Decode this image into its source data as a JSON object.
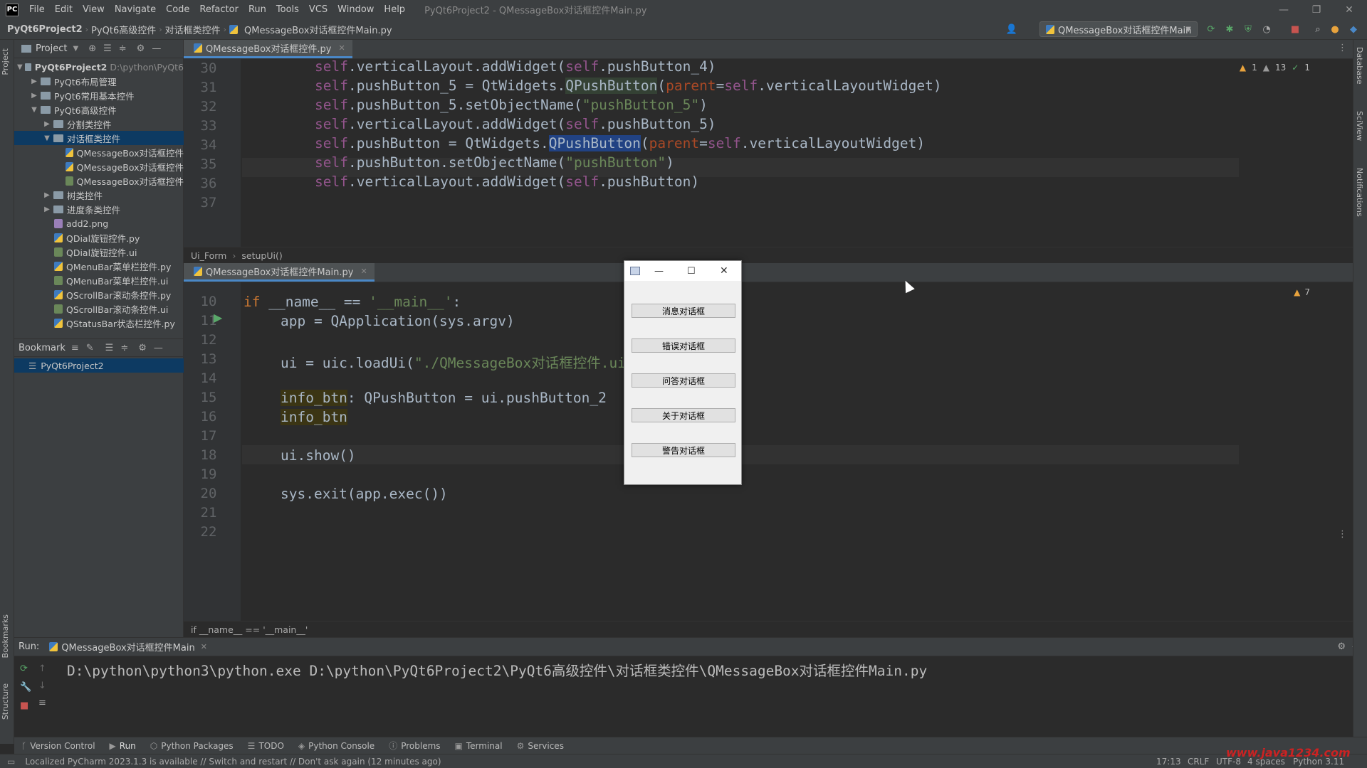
{
  "window": {
    "title": "PyQt6Project2 - QMessageBox对话框控件Main.py",
    "menu": [
      "File",
      "Edit",
      "View",
      "Navigate",
      "Code",
      "Refactor",
      "Run",
      "Tools",
      "VCS",
      "Window",
      "Help"
    ]
  },
  "navbar": {
    "crumbs": [
      "PyQt6Project2",
      "PyQt6高级控件",
      "对话框类控件",
      "QMessageBox对话框控件Main.py"
    ],
    "run_config": "QMessageBox对话框控件Main"
  },
  "left_strip": {
    "project": "Project",
    "bookmarks": "Bookmarks",
    "structure": "Structure"
  },
  "right_strip": {
    "database": "Database",
    "sciview": "SciView",
    "notifications": "Notifications"
  },
  "project_panel": {
    "title": "Project",
    "tree": [
      {
        "label": "PyQt6Project2",
        "muted": "D:\\python\\PyQt6",
        "indent": 0,
        "type": "folder",
        "arrow": "▼",
        "bold": true
      },
      {
        "label": "PyQt6布局管理",
        "indent": 1,
        "type": "folder",
        "arrow": "▶"
      },
      {
        "label": "PyQt6常用基本控件",
        "indent": 1,
        "type": "folder",
        "arrow": "▶"
      },
      {
        "label": "PyQt6高级控件",
        "indent": 1,
        "type": "folder",
        "arrow": "▼"
      },
      {
        "label": "分割类控件",
        "indent": 2,
        "type": "folder",
        "arrow": "▶"
      },
      {
        "label": "对话框类控件",
        "indent": 2,
        "type": "folder",
        "arrow": "▼",
        "selected": true
      },
      {
        "label": "QMessageBox对话框控件",
        "indent": 3,
        "type": "py",
        "arrow": ""
      },
      {
        "label": "QMessageBox对话框控件",
        "indent": 3,
        "type": "py",
        "arrow": ""
      },
      {
        "label": "QMessageBox对话框控件",
        "indent": 3,
        "type": "ui",
        "arrow": ""
      },
      {
        "label": "树类控件",
        "indent": 2,
        "type": "folder",
        "arrow": "▶"
      },
      {
        "label": "进度条类控件",
        "indent": 2,
        "type": "folder",
        "arrow": "▶"
      },
      {
        "label": "add2.png",
        "indent": 2,
        "type": "png",
        "arrow": ""
      },
      {
        "label": "QDial旋钮控件.py",
        "indent": 2,
        "type": "py",
        "arrow": ""
      },
      {
        "label": "QDial旋钮控件.ui",
        "indent": 2,
        "type": "ui",
        "arrow": ""
      },
      {
        "label": "QMenuBar菜单栏控件.py",
        "indent": 2,
        "type": "py",
        "arrow": ""
      },
      {
        "label": "QMenuBar菜单栏控件.ui",
        "indent": 2,
        "type": "ui",
        "arrow": ""
      },
      {
        "label": "QScrollBar滚动条控件.py",
        "indent": 2,
        "type": "py",
        "arrow": ""
      },
      {
        "label": "QScrollBar滚动条控件.ui",
        "indent": 2,
        "type": "ui",
        "arrow": ""
      },
      {
        "label": "QStatusBar状态栏控件.py",
        "indent": 2,
        "type": "py",
        "arrow": ""
      }
    ]
  },
  "bookmark_panel": {
    "title": "Bookmark",
    "items": [
      "PyQt6Project2"
    ]
  },
  "editor_top": {
    "tab": "QMessageBox对话框控件.py",
    "inspections": {
      "warn": "1",
      "weak": "13",
      "ok": "1"
    },
    "breadcrumb": [
      "Ui_Form",
      "setupUi()"
    ],
    "lines": [
      "30",
      "31",
      "32",
      "33",
      "34",
      "35",
      "36",
      "37"
    ]
  },
  "editor_bottom": {
    "tab": "QMessageBox对话框控件Main.py",
    "inspections": {
      "warn": "7"
    },
    "breadcrumb": "if __name__ == '__main__'",
    "lines": [
      "10",
      "11",
      "12",
      "13",
      "14",
      "15",
      "16",
      "17",
      "18",
      "19",
      "20",
      "21",
      "22"
    ]
  },
  "dialog": {
    "buttons": [
      "消息对话框",
      "错误对话框",
      "问答对话框",
      "关于对话框",
      "警告对话框"
    ]
  },
  "run_panel": {
    "label": "Run:",
    "tab": "QMessageBox对话框控件Main",
    "command": "D:\\python\\python3\\python.exe D:\\python\\PyQt6Project2\\PyQt6高级控件\\对话框类控件\\QMessageBox对话框控件Main.py"
  },
  "bottom_tools": [
    "Version Control",
    "Run",
    "Python Packages",
    "TODO",
    "Python Console",
    "Problems",
    "Terminal",
    "Services"
  ],
  "statusbar": {
    "message": "Localized PyCharm 2023.1.3 is available // Switch and restart // Don't ask again (12 minutes ago)",
    "position": "17:13",
    "line_sep": "CRLF",
    "encoding": "UTF-8",
    "indent": "4 spaces",
    "interpreter": "Python 3.11",
    "watermark": "www.java1234.com"
  },
  "colors": {
    "accent": "#4a88c7",
    "selection": "#0d3a62",
    "keyword": "#cc7832",
    "string": "#6a8759",
    "self": "#94558d"
  }
}
